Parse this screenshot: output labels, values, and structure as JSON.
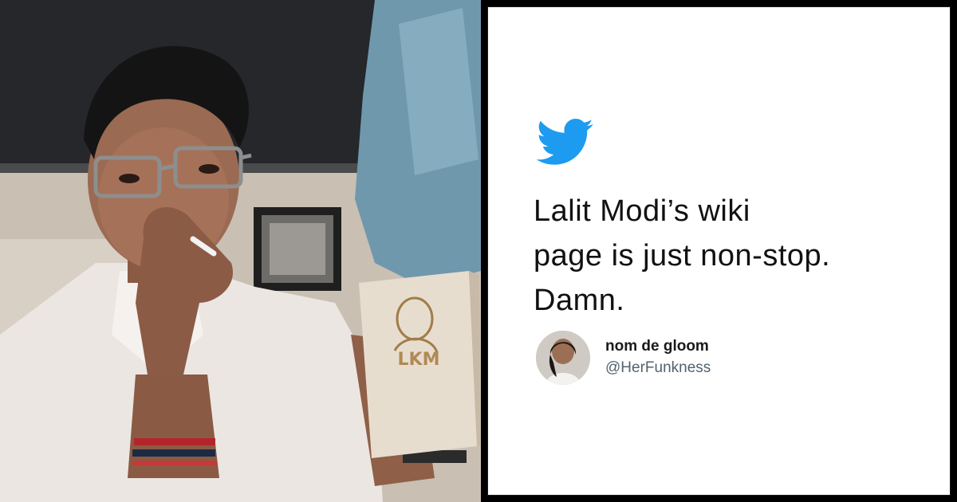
{
  "photo": {
    "box_text": "LKM"
  },
  "tweet": {
    "icon": "twitter-bird-icon",
    "text": "Lalit Modi’s wiki\npage is just non-stop.\nDamn.",
    "author_name": "nom de gloom",
    "author_handle": "@HerFunkness",
    "brand_color": "#1d9bf0"
  }
}
